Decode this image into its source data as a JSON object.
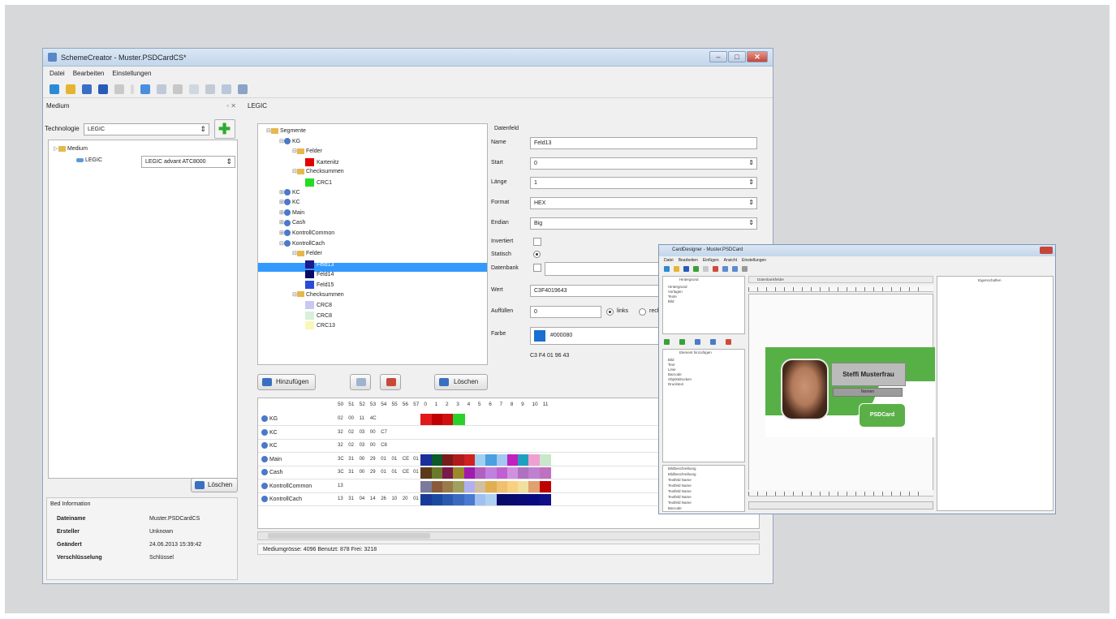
{
  "main_window": {
    "title": "SchemeCreator - Muster.PSDCardCS*",
    "menu": [
      "Datei",
      "Bearbeiten",
      "Einstellungen"
    ],
    "left_panel": {
      "header": "Medium",
      "technology_label": "Technologie",
      "technology_value": "LEGIC",
      "tree": {
        "root": "Medium",
        "child": "LEGIC",
        "child_type": "LEGIC advant ATC8000"
      },
      "delete_button": "Löschen",
      "info": {
        "header": "Bed Information",
        "rows": [
          {
            "key": "Dateiname",
            "value": "Muster.PSDCardCS"
          },
          {
            "key": "Ersteller",
            "value": "Unknown"
          },
          {
            "key": "Geändert",
            "value": "24.06.2013 15:39:42"
          },
          {
            "key": "Verschlüsselung",
            "value": "Schlüssel"
          }
        ]
      }
    },
    "right_header": "LEGIC",
    "tree": [
      {
        "label": "Segmente",
        "level": 0,
        "expand": "-",
        "icon": "folder"
      },
      {
        "label": "KG",
        "level": 1,
        "expand": "-",
        "icon": "key"
      },
      {
        "label": "Felder",
        "level": 2,
        "expand": "-",
        "icon": "folder"
      },
      {
        "label": "Kartenitz",
        "level": 3,
        "swatch": "#e00000"
      },
      {
        "label": "Checksummen",
        "level": 2,
        "expand": "-",
        "icon": "folder"
      },
      {
        "label": "CRC1",
        "level": 3,
        "swatch": "#22dd22"
      },
      {
        "label": "KC",
        "level": 1,
        "expand": "+",
        "icon": "key"
      },
      {
        "label": "KC",
        "level": 1,
        "expand": "+",
        "icon": "key"
      },
      {
        "label": "Main",
        "level": 1,
        "expand": "+",
        "icon": "key"
      },
      {
        "label": "Cash",
        "level": 1,
        "expand": "+",
        "icon": "key"
      },
      {
        "label": "KontrollCommon",
        "level": 1,
        "expand": "+",
        "icon": "key"
      },
      {
        "label": "KontrollCach",
        "level": 1,
        "expand": "-",
        "icon": "key"
      },
      {
        "label": "Felder",
        "level": 2,
        "expand": "-",
        "icon": "folder"
      },
      {
        "label": "Feld13",
        "level": 3,
        "swatch": "#1a1a8c",
        "selected": true
      },
      {
        "label": "Feld14",
        "level": 3,
        "swatch": "#0a0a6a"
      },
      {
        "label": "Feld15",
        "level": 3,
        "swatch": "#2a4ad8"
      },
      {
        "label": "Checksummen",
        "level": 2,
        "expand": "-",
        "icon": "folder"
      },
      {
        "label": "CRC8",
        "level": 3,
        "swatch": "#c8c8f0"
      },
      {
        "label": "CRC8",
        "level": 3,
        "swatch": "#d8f0d8"
      },
      {
        "label": "CRC13",
        "level": 3,
        "swatch": "#f8f8b8"
      }
    ],
    "buttons": {
      "add": "Hinzufügen",
      "delete": "Löschen"
    },
    "datenfeld": {
      "legend": "Datenfeld",
      "name_label": "Name",
      "name_value": "Feld13",
      "start_label": "Start",
      "start_value": "0",
      "laenge_label": "Länge",
      "laenge_value": "1",
      "format_label": "Format",
      "format_value": "HEX",
      "endian_label": "Endian",
      "endian_value": "Big",
      "invertiert_label": "Invertiert",
      "statisch_label": "Statisch",
      "datenbank_label": "Datenbank",
      "wert_label": "Wert",
      "wert_value": "C3F4019643",
      "auffuellen_label": "Auffüllen",
      "auffuellen_value": "0",
      "links_label": "links",
      "rechts_label": "rechts",
      "farbe_label": "Farbe",
      "farbe_value": "#000080",
      "farbe_swatch": "#1a6fd0",
      "hexline": "C3 F4 01 96 43"
    },
    "grid": {
      "headers": [
        "50",
        "51",
        "52",
        "53",
        "54",
        "55",
        "56",
        "57",
        "0",
        "1",
        "2",
        "3",
        "4",
        "5",
        "6",
        "7",
        "8",
        "9",
        "10",
        "11"
      ],
      "rows": [
        {
          "label": "KG",
          "cells": [
            "02",
            "00",
            "11",
            "4C"
          ]
        },
        {
          "label": "KC",
          "cells": [
            "32",
            "02",
            "03",
            "00",
            "C7"
          ]
        },
        {
          "label": "KC",
          "cells": [
            "32",
            "02",
            "03",
            "00",
            "C8"
          ]
        },
        {
          "label": "Main",
          "cells": [
            "3C",
            "31",
            "00",
            "29",
            "01",
            "01",
            "CE",
            "01"
          ]
        },
        {
          "label": "Cash",
          "cells": [
            "3C",
            "31",
            "00",
            "29",
            "01",
            "01",
            "CE",
            "01"
          ]
        },
        {
          "label": "KontrollCommon",
          "cells": [
            "13"
          ]
        },
        {
          "label": "KontrollCach",
          "cells": [
            "13",
            "31",
            "04",
            "14",
            "26",
            "10",
            "20",
            "01"
          ]
        }
      ]
    },
    "status": "Mediumgrösse: 4096 Benutzt: 878 Frei: 3218"
  },
  "second_window": {
    "title": "CardDesigner - Muster.PSDCard",
    "menu": [
      "Datei",
      "Bearbeiten",
      "Einfügen",
      "Ansicht",
      "Einstellungen"
    ],
    "layer_items": [
      "Hintergrund",
      "Vorlagen",
      "Texte",
      "Bild"
    ],
    "panel_titles": [
      "Element hinzufügen",
      "Hintergrund",
      "Datenbankfelder",
      "Eigenschaften"
    ],
    "element_items": [
      "Bild",
      "Text",
      "Linie",
      "Barcode",
      "Objektdrucken",
      "Drucktext"
    ],
    "list_items": [
      "Bildbeschreibung",
      "Bildbeschreibung",
      "Textfeld Name",
      "Textfeld Name",
      "Textfeld Name",
      "Textfeld Name",
      "Textfeld Name",
      "Barcode"
    ],
    "card": {
      "name": "Steffi Musterfrau",
      "role": "Nomen",
      "logo": "PSDCard"
    },
    "card_colors": {
      "green": "#57b046"
    }
  }
}
